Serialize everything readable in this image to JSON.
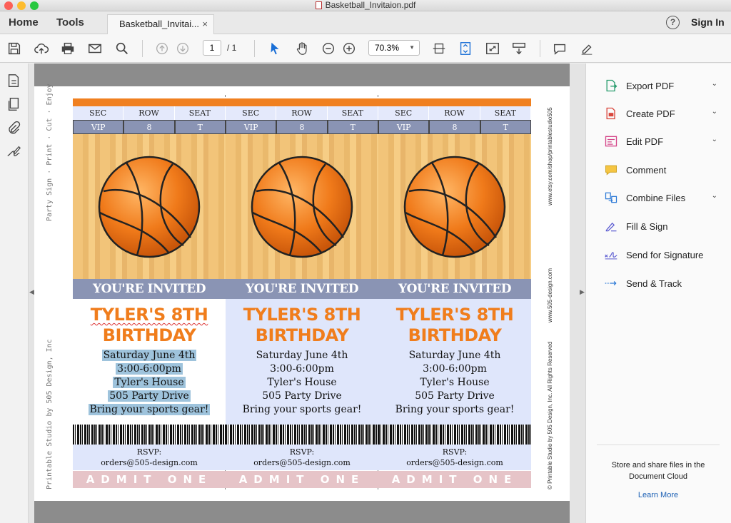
{
  "window": {
    "title": "Basketball_Invitaion.pdf"
  },
  "nav": {
    "home": "Home",
    "tools": "Tools",
    "doc_tab": "Basketball_Invitai...",
    "tab_close": "×",
    "help": "?",
    "sign_in": "Sign In"
  },
  "toolbar": {
    "page_current": "1",
    "page_total": "/ 1",
    "zoom": "70.3%"
  },
  "document": {
    "side_left_top": "Party Sign · Print · Cut · Enjoy",
    "side_left_bottom": "Printable Studio by 505 Design, Inc",
    "side_right_top": "www.etsy.com/shop/printablestudio505",
    "side_right_mid": "www.505-design.com",
    "side_right_bottom": "© Printable Studio by 505 Design, Inc. All Rights Reserved",
    "tickets": [
      {
        "sec_label": "SEC",
        "row_label": "ROW",
        "seat_label": "SEAT",
        "sec": "VIP",
        "row": "8",
        "seat": "T",
        "invited": "YOU'RE INVITED",
        "name_line1": "TYLER'S 8TH",
        "name_line2": "BIRTHDAY",
        "date": "Saturday June 4th",
        "time": "3:00-6:00pm",
        "place": "Tyler's House",
        "address": "505 Party Drive",
        "note": "Bring your sports gear!",
        "rsvp": "RSVP:",
        "email": "orders@505-design.com",
        "admit": "ADMIT ONE"
      },
      {
        "sec_label": "SEC",
        "row_label": "ROW",
        "seat_label": "SEAT",
        "sec": "VIP",
        "row": "8",
        "seat": "T",
        "invited": "YOU'RE INVITED",
        "name_line1": "TYLER'S 8TH",
        "name_line2": "BIRTHDAY",
        "date": "Saturday June 4th",
        "time": "3:00-6:00pm",
        "place": "Tyler's House",
        "address": "505 Party Drive",
        "note": "Bring your sports gear!",
        "rsvp": "RSVP:",
        "email": "orders@505-design.com",
        "admit": "ADMIT ONE"
      },
      {
        "sec_label": "SEC",
        "row_label": "ROW",
        "seat_label": "SEAT",
        "sec": "VIP",
        "row": "8",
        "seat": "T",
        "invited": "YOU'RE INVITED",
        "name_line1": "TYLER'S 8TH",
        "name_line2": "BIRTHDAY",
        "date": "Saturday June 4th",
        "time": "3:00-6:00pm",
        "place": "Tyler's House",
        "address": "505 Party Drive",
        "note": "Bring your sports gear!",
        "rsvp": "RSVP:",
        "email": "orders@505-design.com",
        "admit": "ADMIT ONE"
      }
    ]
  },
  "right_panel": {
    "items": [
      {
        "label": "Export PDF",
        "icon": "export-pdf-icon"
      },
      {
        "label": "Create PDF",
        "icon": "create-pdf-icon"
      },
      {
        "label": "Edit PDF",
        "icon": "edit-pdf-icon"
      },
      {
        "label": "Comment",
        "icon": "comment-icon"
      },
      {
        "label": "Combine Files",
        "icon": "combine-files-icon"
      },
      {
        "label": "Fill & Sign",
        "icon": "fill-sign-icon"
      },
      {
        "label": "Send for Signature",
        "icon": "send-signature-icon"
      },
      {
        "label": "Send & Track",
        "icon": "send-track-icon"
      }
    ],
    "cloud_text_1": "Store and share files in the",
    "cloud_text_2": "Document Cloud",
    "learn_more": "Learn More"
  },
  "colors": {
    "accent_orange": "#f07d1c",
    "ticket_blue": "#dfe6fb",
    "slate": "#8a94b4",
    "admit_pink": "#e6c4c8"
  }
}
